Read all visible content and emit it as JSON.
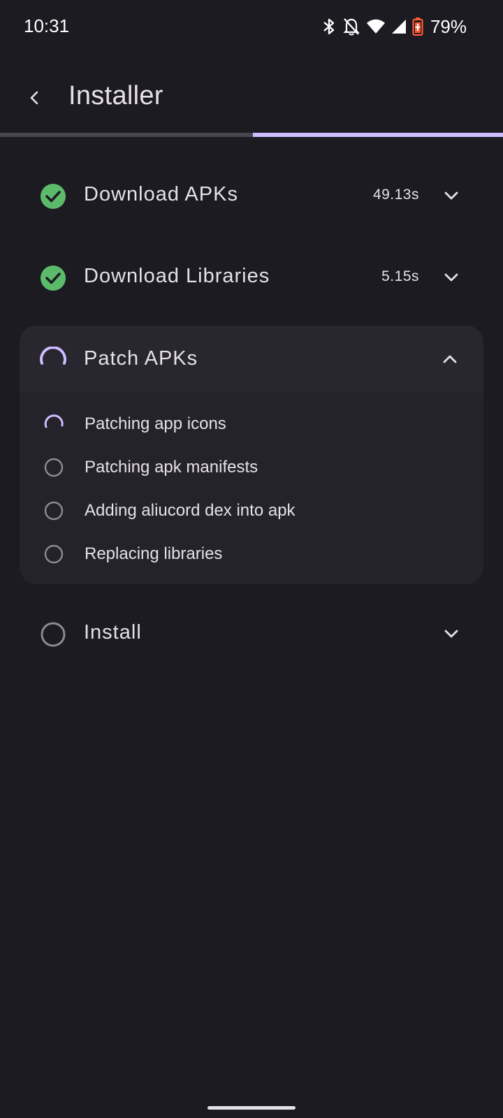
{
  "status_bar": {
    "time": "10:31",
    "battery": "79%",
    "icons": [
      "bluetooth-icon",
      "notifications-off-icon",
      "wifi-icon",
      "cell-signal-icon",
      "battery-charging-icon"
    ]
  },
  "app_bar": {
    "title": "Installer",
    "back_icon": "back-arrow-icon"
  },
  "progress": {
    "fraction": 0.5
  },
  "colors": {
    "background": "#1c1b21",
    "accent": "#cfbcff",
    "success": "#5cbb6b",
    "pending": "#8d8a93",
    "card": "#24222a"
  },
  "steps": [
    {
      "label": "Download APKs",
      "status": "completed",
      "time": "49.13s",
      "expanded": false
    },
    {
      "label": "Download Libraries",
      "status": "completed",
      "time": "5.15s",
      "expanded": false
    },
    {
      "label": "Patch APKs",
      "status": "in-progress",
      "time": "",
      "expanded": true,
      "substeps": [
        {
          "label": "Patching app icons",
          "status": "in-progress"
        },
        {
          "label": "Patching apk manifests",
          "status": "pending"
        },
        {
          "label": "Adding aliucord dex into apk",
          "status": "pending"
        },
        {
          "label": "Replacing libraries",
          "status": "pending"
        }
      ]
    },
    {
      "label": "Install",
      "status": "pending",
      "time": "",
      "expanded": false
    }
  ]
}
